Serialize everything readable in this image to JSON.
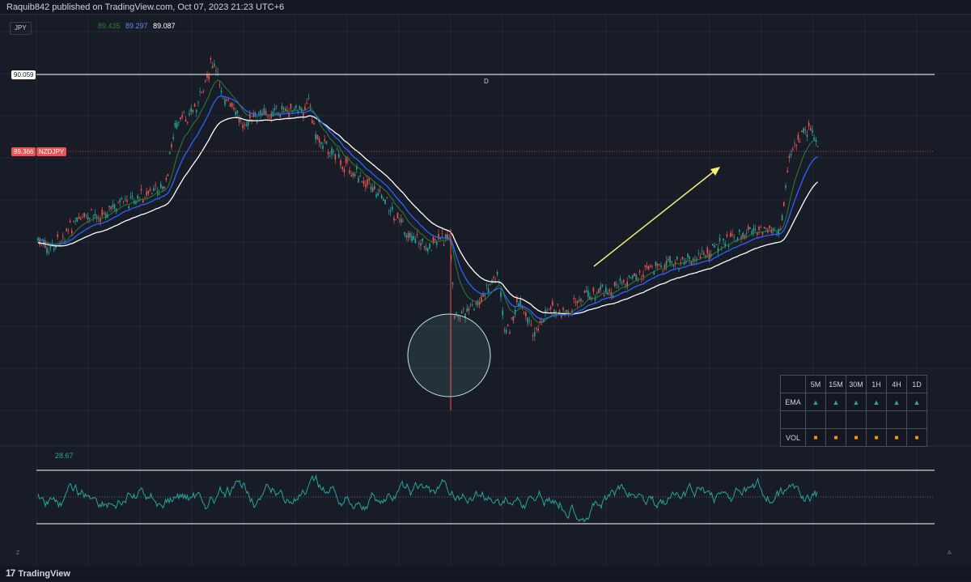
{
  "header": {
    "publish_text": "Raquib842 published on TradingView.com, Oct 07, 2023 21:23 UTC+6"
  },
  "chart": {
    "symbol_chip": "JPY",
    "ema_values": [
      "89.435",
      "89.297",
      "89.087"
    ],
    "level_label": "90.059",
    "level_marker": "D",
    "last_price": "89.366",
    "symbol_tag": "NZDJPY",
    "colors": {
      "background": "#181c27",
      "up_candle": "#26a69a",
      "down_candle": "#ef5350",
      "ema_fast": "#2e7d32",
      "ema_mid": "#2962ff",
      "ema_slow": "#ffffff",
      "arrow": "#f5f07a",
      "circle": "#7fd1c0"
    },
    "annotations": [
      "horizontal-level-line",
      "yellow-up-arrow",
      "circle-highlight"
    ]
  },
  "trend_table": {
    "columns": [
      "",
      "5M",
      "15M",
      "30M",
      "1H",
      "4H",
      "1D"
    ],
    "rows": [
      {
        "label": "EMA",
        "cells": [
          "▲",
          "▲",
          "▲",
          "▲",
          "▲",
          "▲"
        ]
      },
      {
        "label": "",
        "cells": [
          "",
          "",
          "",
          "",
          "",
          ""
        ]
      },
      {
        "label": "VOL",
        "cells": [
          "■",
          "■",
          "■",
          "■",
          "■",
          "■"
        ]
      }
    ]
  },
  "oscillator": {
    "value": "28.67",
    "color": "#26a69a"
  },
  "footer": {
    "brand": "TradingView",
    "left_mark": "Z",
    "right_mark": "A"
  }
}
